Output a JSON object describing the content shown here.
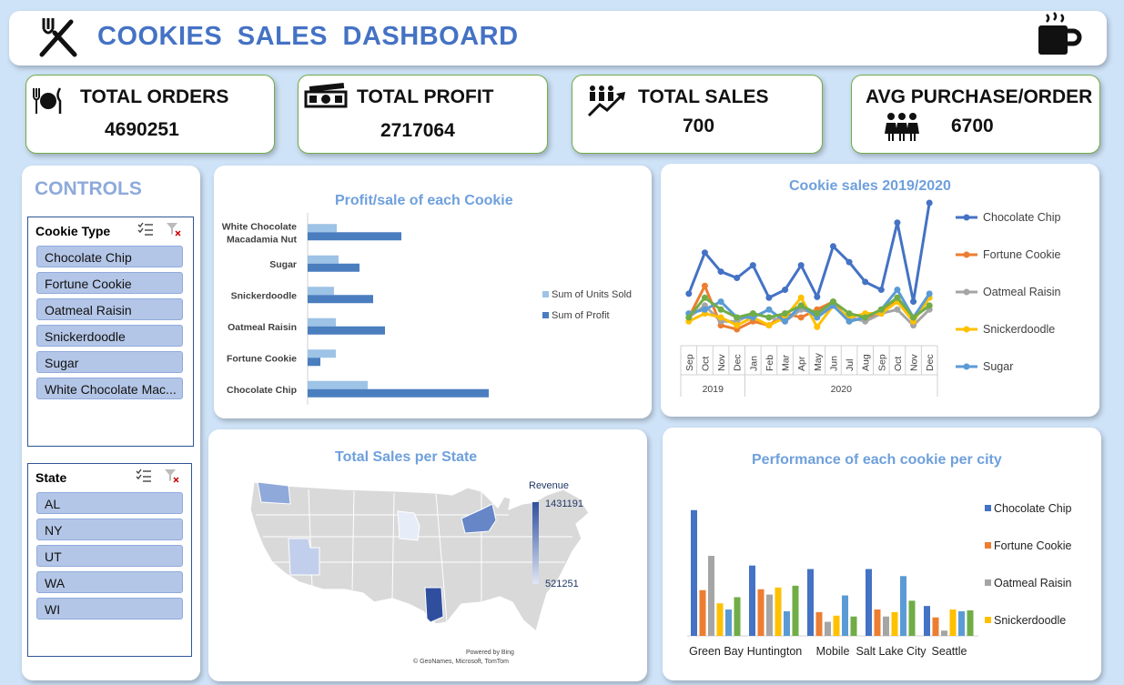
{
  "header": {
    "title": "COOKIES  SALES  DASHBOARD"
  },
  "kpis": [
    {
      "label": "TOTAL ORDERS",
      "value": "4690251",
      "icon": "dining-icon"
    },
    {
      "label": "TOTAL PROFIT",
      "value": "2717064",
      "icon": "money-icon"
    },
    {
      "label": "TOTAL SALES",
      "value": "700",
      "icon": "growth-people-icon"
    },
    {
      "label": "AVG PURCHASE/ORDER",
      "value": "6700",
      "icon": "people-icon"
    }
  ],
  "controls": {
    "title": "CONTROLS",
    "cookie_slicer": {
      "title": "Cookie Type",
      "items": [
        "Chocolate Chip",
        "Fortune Cookie",
        "Oatmeal Raisin",
        "Snickerdoodle",
        "Sugar",
        "White Chocolate Mac..."
      ]
    },
    "state_slicer": {
      "title": "State",
      "items": [
        "AL",
        "NY",
        "UT",
        "WA",
        "WI"
      ]
    }
  },
  "colors": {
    "accent": "#4472c4",
    "light_blue": "#9dc3e6",
    "orange": "#ed7d31",
    "gray": "#a5a5a5",
    "gold": "#ffc000",
    "sky": "#5b9bd5",
    "green": "#70ad47",
    "kpi_border": "#70ad47"
  },
  "chart_data": [
    {
      "type": "bar",
      "orientation": "horizontal",
      "title": "Profit/sale of each Cookie",
      "categories": [
        "White Chocolate Macadamia Nut",
        "Sugar",
        "Snickerdoodle",
        "Oatmeal Raisin",
        "Fortune Cookie",
        "Chocolate Chip"
      ],
      "category_lines": [
        [
          "White Chocolate",
          "Macadamia Nut"
        ],
        [
          "Sugar"
        ],
        [
          "Snickerdoodle"
        ],
        [
          "Oatmeal Raisin"
        ],
        [
          "Fortune Cookie"
        ],
        [
          "Chocolate Chip"
        ]
      ],
      "series": [
        {
          "name": "Sum of Units Sold",
          "color": "#9dc3e6",
          "values": [
            32,
            34,
            29,
            31,
            31,
            66
          ]
        },
        {
          "name": "Sum of Profit",
          "color": "#4a7ebf",
          "values": [
            103,
            57,
            72,
            85,
            14,
            199
          ]
        }
      ],
      "legend": "right"
    },
    {
      "type": "line",
      "title": "Cookie sales 2019/2020",
      "x": [
        "Sep",
        "Oct",
        "Nov",
        "Dec",
        "Jan",
        "Feb",
        "Mar",
        "Apr",
        "May",
        "Jun",
        "Jul",
        "Aug",
        "Sep",
        "Oct",
        "Nov",
        "Dec"
      ],
      "x_groups": [
        {
          "label": "2019",
          "count": 4
        },
        {
          "label": "2020",
          "count": 12
        }
      ],
      "series": [
        {
          "name": "Chocolate Chip",
          "color": "#4472c4",
          "values": [
            60,
            112,
            88,
            80,
            96,
            55,
            65,
            96,
            56,
            120,
            100,
            75,
            65,
            150,
            50,
            175
          ]
        },
        {
          "name": "Fortune Cookie",
          "color": "#ed7d31",
          "values": [
            30,
            70,
            20,
            15,
            25,
            20,
            35,
            30,
            40,
            50,
            25,
            30,
            35,
            55,
            30,
            45
          ]
        },
        {
          "name": "Oatmeal Raisin",
          "color": "#a5a5a5",
          "values": [
            30,
            45,
            25,
            25,
            35,
            30,
            25,
            40,
            35,
            45,
            30,
            25,
            35,
            40,
            20,
            40
          ]
        },
        {
          "name": "Snickerdoodle",
          "color": "#ffc000",
          "values": [
            25,
            35,
            30,
            20,
            30,
            20,
            30,
            55,
            18,
            45,
            30,
            35,
            35,
            50,
            25,
            55
          ]
        },
        {
          "name": "Sugar",
          "color": "#5b9bd5",
          "values": [
            35,
            40,
            50,
            30,
            30,
            40,
            25,
            45,
            30,
            45,
            25,
            30,
            40,
            65,
            30,
            60
          ]
        },
        {
          "name": "",
          "color": "#70ad47",
          "values": [
            30,
            55,
            40,
            30,
            35,
            30,
            35,
            45,
            35,
            50,
            35,
            30,
            40,
            55,
            30,
            45
          ]
        }
      ],
      "ylim": [
        0,
        190
      ],
      "legend": "right"
    },
    {
      "type": "map",
      "title": "Total Sales per State",
      "legend_title": "Revenue",
      "legend_max": "1431191",
      "legend_min": "521251",
      "regions": [
        {
          "state": "WA",
          "level": 0.6
        },
        {
          "state": "UT",
          "level": 0.35
        },
        {
          "state": "WI",
          "level": 0.1
        },
        {
          "state": "NY",
          "level": 0.75
        },
        {
          "state": "AL",
          "level": 1.0
        }
      ],
      "attribution": [
        "Powered by Bing",
        "© GeoNames, Microsoft, TomTom"
      ]
    },
    {
      "type": "bar",
      "title": "Performance of each cookie per city",
      "categories": [
        "Green Bay",
        "Huntington",
        "Mobile",
        "Salt Lake City",
        "Seattle"
      ],
      "series": [
        {
          "name": "Chocolate Chip",
          "color": "#4472c4",
          "values": [
            143,
            80,
            76,
            76,
            34
          ]
        },
        {
          "name": "Fortune Cookie",
          "color": "#ed7d31",
          "values": [
            52,
            53,
            27,
            30,
            21
          ]
        },
        {
          "name": "Oatmeal Raisin",
          "color": "#a5a5a5",
          "values": [
            91,
            47,
            16,
            22,
            6
          ]
        },
        {
          "name": "Snickerdoodle",
          "color": "#ffc000",
          "values": [
            37,
            55,
            23,
            27,
            30
          ]
        },
        {
          "name": "Sugar",
          "color": "#5b9bd5",
          "values": [
            30,
            28,
            46,
            68,
            28
          ]
        },
        {
          "name": "",
          "color": "#70ad47",
          "values": [
            44,
            57,
            22,
            40,
            29
          ]
        }
      ],
      "legend_items": [
        "Chocolate Chip",
        "Fortune Cookie",
        "Oatmeal Raisin",
        "Snickerdoodle"
      ],
      "ylim": [
        0,
        150
      ],
      "legend": "right"
    }
  ]
}
